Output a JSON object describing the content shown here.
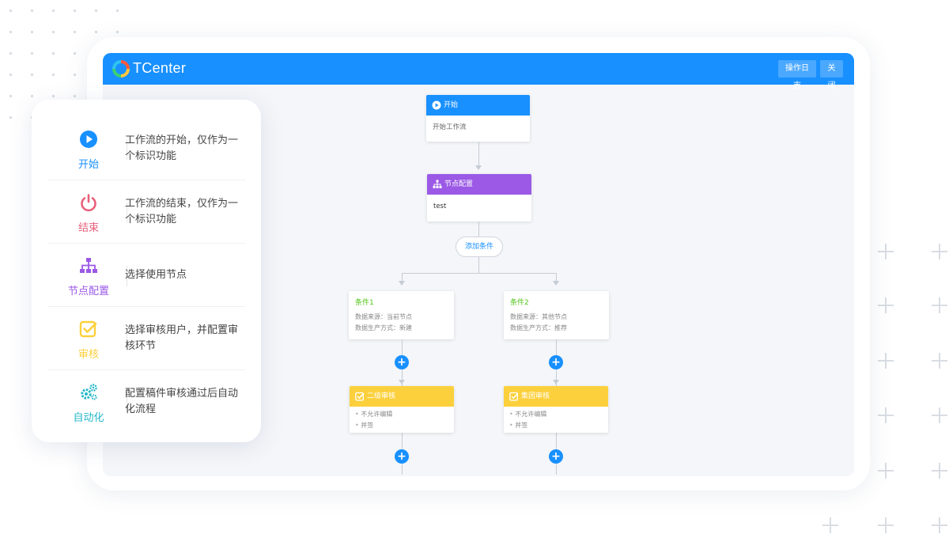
{
  "colors": {
    "primary": "#1890ff",
    "purple": "#9b59e6",
    "yellow": "#fcd03c",
    "pink": "#e8607a",
    "teal": "#27b8c8",
    "green": "#52c41a"
  },
  "app": {
    "brand": "TCenter",
    "buttons": {
      "log": "操作日志",
      "close": "关闭"
    }
  },
  "flow": {
    "start": {
      "icon": "play-icon",
      "title": "开始",
      "body": "开始工作流"
    },
    "node_config": {
      "icon": "hierarchy-icon",
      "title": "节点配置",
      "body": "test"
    },
    "add_condition": "添加条件",
    "conditions": [
      {
        "title": "条件1",
        "lines": [
          "数据来源：当前节点",
          "数据生产方式：新建"
        ]
      },
      {
        "title": "条件2",
        "lines": [
          "数据来源：其他节点",
          "数据生产方式：推荐"
        ]
      }
    ],
    "reviews": [
      {
        "icon": "checkbox-icon",
        "title": "二级审核",
        "bullets": [
          "不允许编辑",
          "并签"
        ]
      },
      {
        "icon": "checkbox-icon",
        "title": "集团审核",
        "bullets": [
          "不允许编辑",
          "并签"
        ]
      }
    ]
  },
  "legend": [
    {
      "icon": "play-icon",
      "label": "开始",
      "desc": "工作流的开始，仅作为一个标识功能"
    },
    {
      "icon": "power-icon",
      "label": "结束",
      "desc": "工作流的结束，仅作为一个标识功能"
    },
    {
      "icon": "hierarchy-icon",
      "label": "节点配置",
      "desc": "选择使用节点"
    },
    {
      "icon": "checkbox-icon",
      "label": "审核",
      "desc": "选择审核用户，并配置审核环节"
    },
    {
      "icon": "gears-icon",
      "label": "自动化",
      "desc": "配置稿件审核通过后自动化流程"
    }
  ]
}
